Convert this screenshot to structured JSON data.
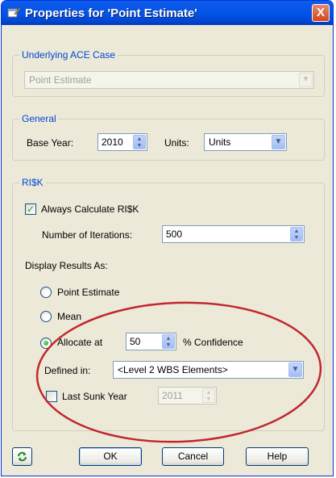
{
  "window": {
    "title": "Properties for 'Point Estimate'",
    "close": "X"
  },
  "underlying": {
    "label": "Underlying ACE Case",
    "case_value": "Point Estimate"
  },
  "general": {
    "label": "General",
    "base_year_label": "Base Year:",
    "base_year_value": "2010",
    "units_label": "Units:",
    "units_value": "Units"
  },
  "risk": {
    "label": "RI$K",
    "always_calc_label": "Always Calculate RI$K",
    "always_calc_checked": true,
    "iterations_label": "Number of Iterations:",
    "iterations_value": "500",
    "display_label": "Display Results As:",
    "opt_point": "Point Estimate",
    "opt_mean": "Mean",
    "opt_allocate": "Allocate at",
    "allocate_value": "50",
    "confidence_label": "% Confidence",
    "selected_option": "Allocate at",
    "defined_in_label": "Defined in:",
    "defined_in_value": "<Level 2 WBS Elements>",
    "last_sunk_label": "Last Sunk Year",
    "last_sunk_checked": false,
    "last_sunk_value": "2011"
  },
  "buttons": {
    "ok": "OK",
    "cancel": "Cancel",
    "help": "Help"
  },
  "colors": {
    "group_label": "#0046d5",
    "highlight_ellipse": "#c0282d",
    "titlebar": "#0355e9"
  }
}
